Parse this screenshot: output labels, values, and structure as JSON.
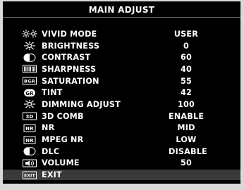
{
  "title": "MAIN ADJUST",
  "menu": [
    {
      "label": "VIVID MODE",
      "value": "USER",
      "icon": "vivid-mode-icon"
    },
    {
      "label": "BRIGHTNESS",
      "value": "0",
      "icon": "brightness-icon"
    },
    {
      "label": "CONTRAST",
      "value": "60",
      "icon": "contrast-icon"
    },
    {
      "label": "SHARPNESS",
      "value": "40",
      "icon": "sharpness-icon"
    },
    {
      "label": "SATURATION",
      "value": "55",
      "icon": "saturation-icon"
    },
    {
      "label": "TINT",
      "value": "42",
      "icon": "tint-icon"
    },
    {
      "label": "DIMMING ADJUST",
      "value": "100",
      "icon": "dimming-icon"
    },
    {
      "label": "3D COMB",
      "value": "ENABLE",
      "icon": "3d-comb-icon"
    },
    {
      "label": "NR",
      "value": "MID",
      "icon": "nr-icon"
    },
    {
      "label": "MPEG NR",
      "value": "LOW",
      "icon": "mpeg-nr-icon"
    },
    {
      "label": "DLC",
      "value": "DISABLE",
      "icon": "dlc-icon"
    },
    {
      "label": "VOLUME",
      "value": "50",
      "icon": "volume-icon"
    },
    {
      "label": "EXIT",
      "value": "",
      "icon": "exit-icon"
    }
  ],
  "icon_text": {
    "saturation": "BGR",
    "tint": "GR",
    "comb": "3D",
    "nr": "NR",
    "mpeg_nr": "NR",
    "exit": "EXIT"
  },
  "selected_index": 12,
  "colors": {
    "background": "#000000",
    "text": "#ffffff",
    "selected_row": "#3a3a3a"
  }
}
